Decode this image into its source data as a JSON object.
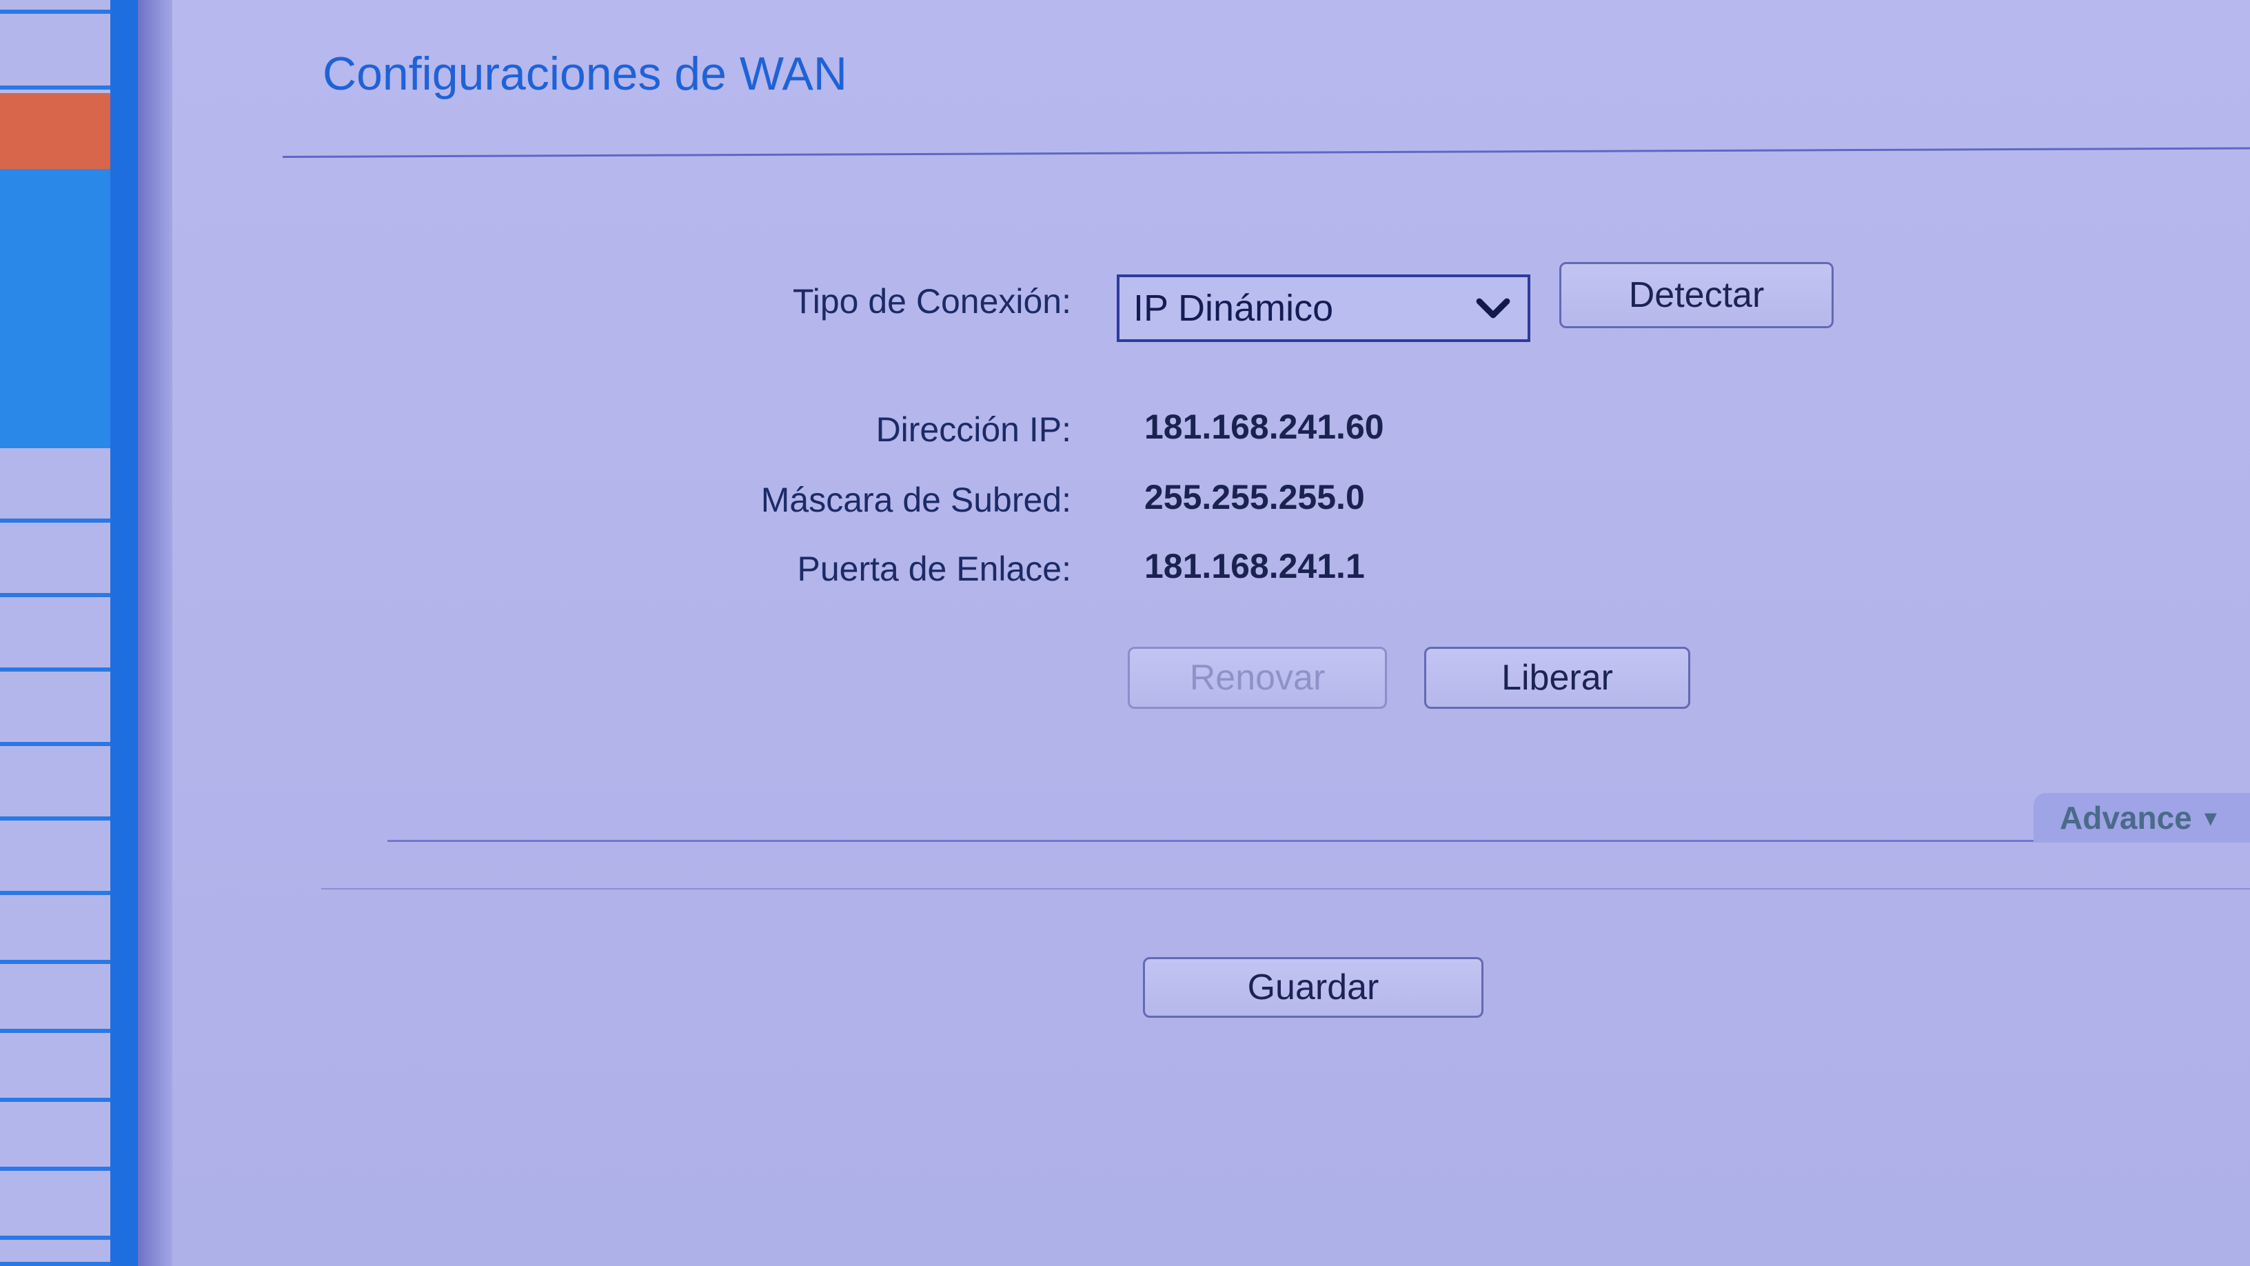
{
  "page_title": "Configuraciones de WAN",
  "form": {
    "connection_type": {
      "label": "Tipo de Conexión:",
      "selected": "IP Dinámico",
      "detect_label": "Detectar"
    },
    "ip_address": {
      "label": "Dirección IP:",
      "value": "181.168.241.60"
    },
    "subnet_mask": {
      "label": "Máscara de Subred:",
      "value": "255.255.255.0"
    },
    "gateway": {
      "label": "Puerta de Enlace:",
      "value": "181.168.241.1"
    }
  },
  "actions": {
    "renew_label": "Renovar",
    "release_label": "Liberar",
    "save_label": "Guardar"
  },
  "advanced_label": "Advance",
  "colors": {
    "background": "#b4b6ec",
    "title": "#1f62d6",
    "sidebar_accent": "#1f6ee0",
    "sidebar_active": "#d8664a"
  }
}
